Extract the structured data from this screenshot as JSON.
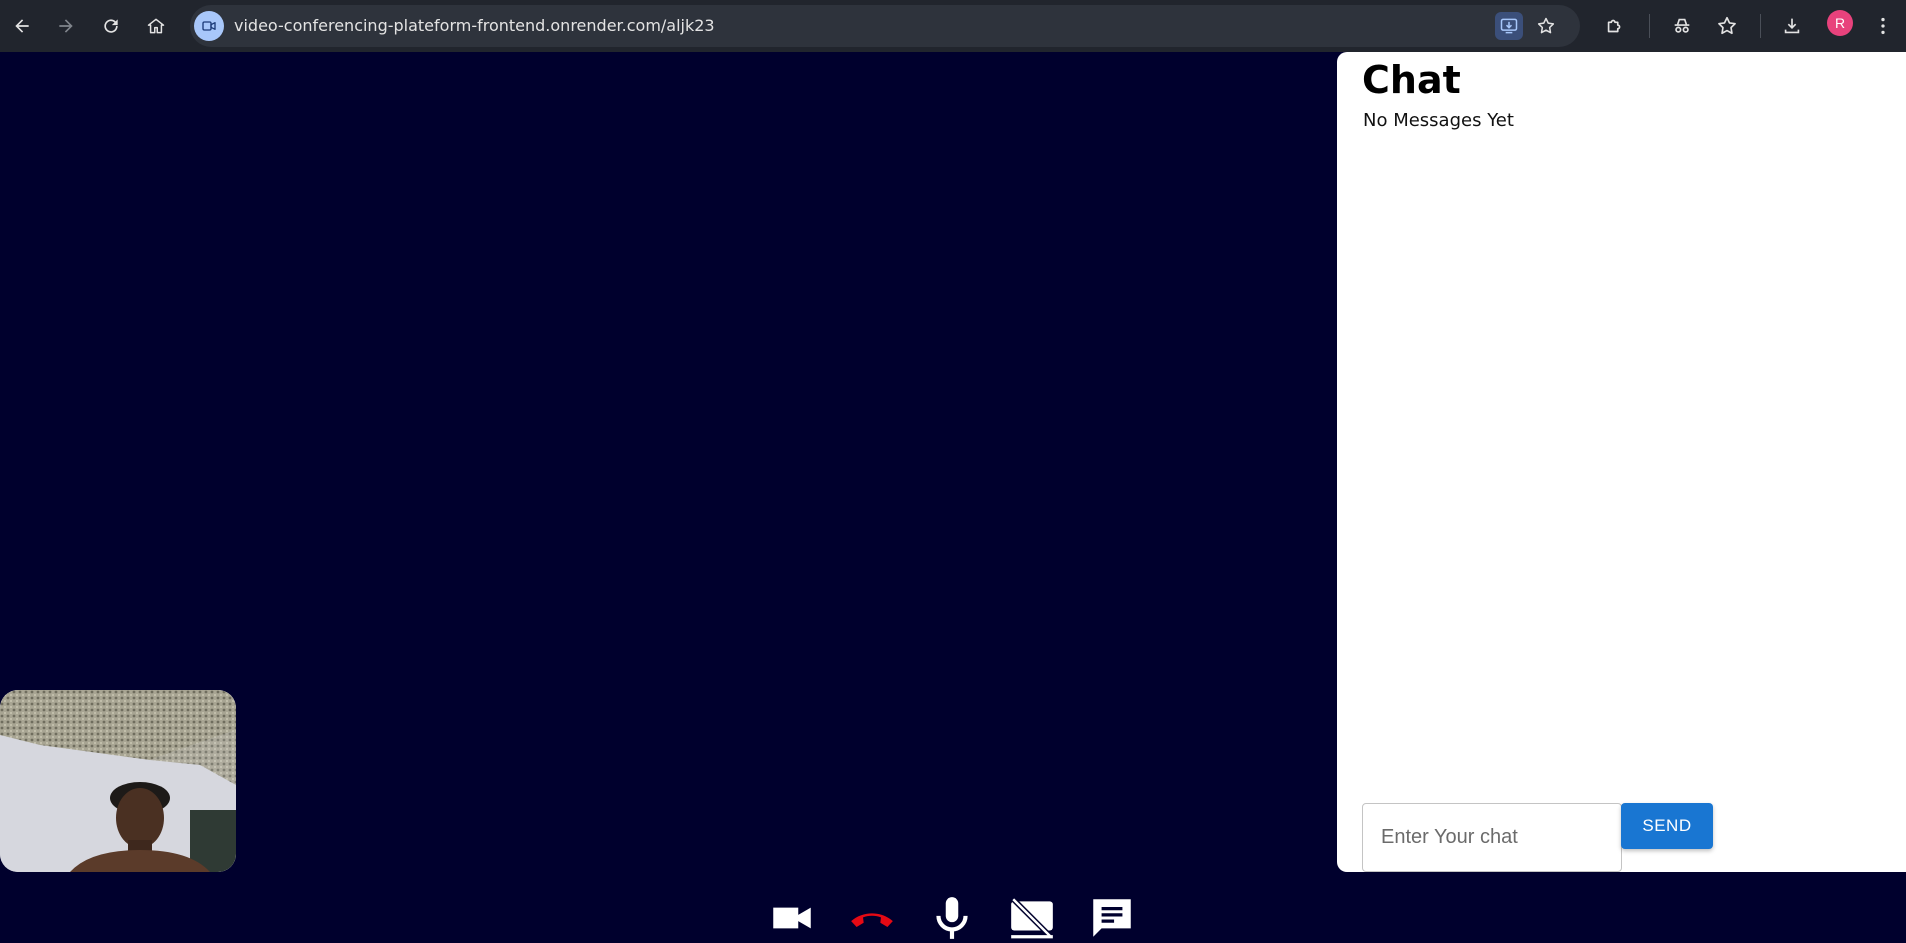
{
  "browser": {
    "url": "video-conferencing-plateform-frontend.onrender.com/aljk23",
    "profile_initial": "R",
    "profile_color": "#e8427c"
  },
  "chat": {
    "title": "Chat",
    "empty_message": "No Messages Yet",
    "input_placeholder": "Enter Your chat",
    "input_value": "",
    "send_label": "SEND"
  },
  "colors": {
    "background": "#00002d",
    "accent": "#1976d2",
    "end_call": "#e50914"
  },
  "controls": [
    {
      "name": "camera",
      "icon": "videocam-icon"
    },
    {
      "name": "end-call",
      "icon": "call-end-icon"
    },
    {
      "name": "microphone",
      "icon": "mic-icon"
    },
    {
      "name": "screen-share",
      "icon": "stop-screen-share-icon"
    },
    {
      "name": "chat",
      "icon": "chat-icon"
    }
  ]
}
